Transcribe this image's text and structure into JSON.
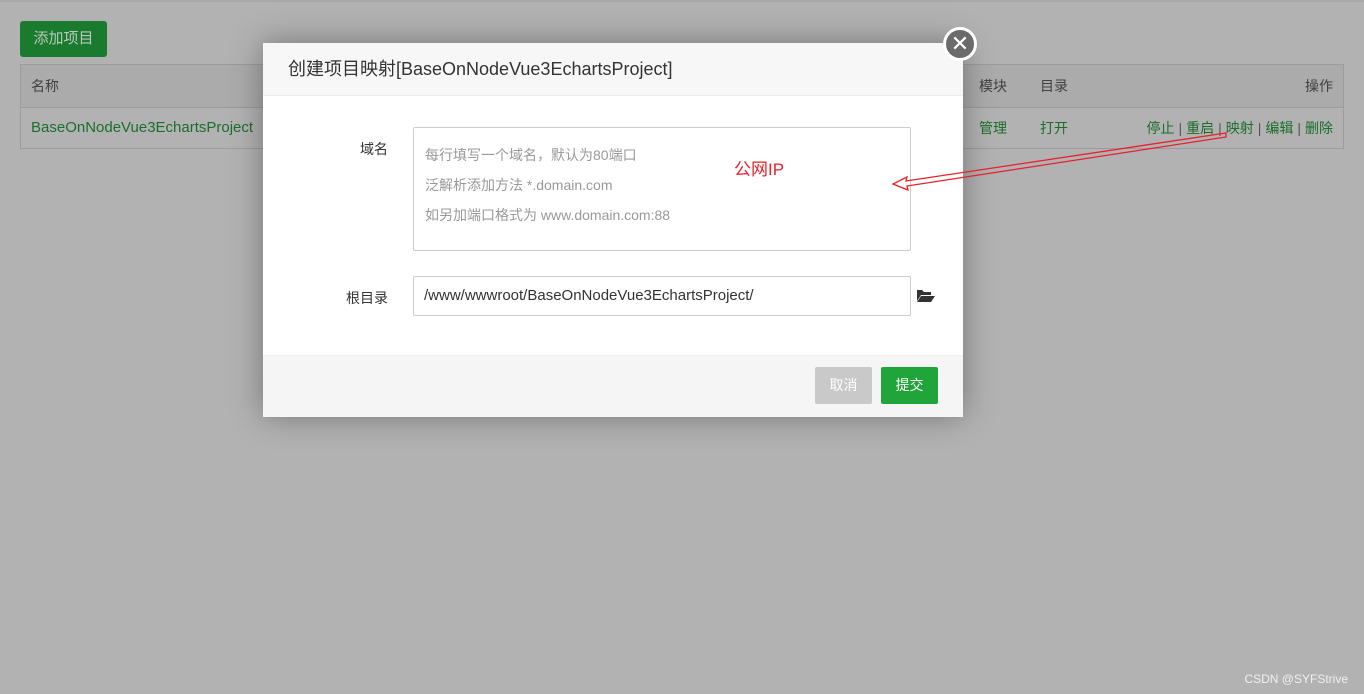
{
  "toolbar": {
    "add_project": "添加项目"
  },
  "table": {
    "headers": {
      "name": "名称",
      "module": "模块",
      "directory": "目录",
      "actions": "操作"
    },
    "rows": [
      {
        "name": "BaseOnNodeVue3EchartsProject",
        "module": "管理",
        "directory": "打开",
        "actions": {
          "stop": "停止",
          "restart": "重启",
          "map": "映射",
          "edit": "编辑",
          "delete": "删除"
        }
      }
    ]
  },
  "modal": {
    "title": "创建项目映射[BaseOnNodeVue3EchartsProject]",
    "domain_label": "域名",
    "domain_placeholder": [
      "每行填写一个域名，默认为80端口",
      "泛解析添加方法 *.domain.com",
      "如另加端口格式为 www.domain.com:88"
    ],
    "root_label": "根目录",
    "root_value": "/www/wwwroot/BaseOnNodeVue3EchartsProject/",
    "cancel": "取消",
    "submit": "提交"
  },
  "annotation": {
    "text": "公网IP",
    "color": "#e8202a"
  },
  "watermark": "CSDN @SYFStrive",
  "colors": {
    "accent": "#20a53a",
    "overlay": "#b2b2b2"
  }
}
